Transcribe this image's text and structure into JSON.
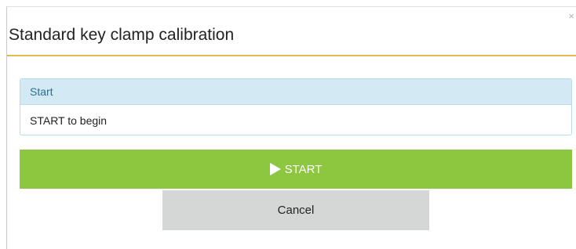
{
  "dialog": {
    "title": "Standard key clamp calibration",
    "close_label": "×"
  },
  "panel": {
    "heading": "Start",
    "body": "START to begin"
  },
  "actions": {
    "start_label": "START",
    "cancel_label": "Cancel"
  },
  "colors": {
    "header_rule": "#e6b94a",
    "panel_heading_bg": "#d3eaf4",
    "panel_heading_text": "#2e6e93",
    "start_bg": "#8dc63f",
    "cancel_bg": "#d5d7d6"
  },
  "icons": {
    "close": "close-icon",
    "start": "play-icon"
  }
}
